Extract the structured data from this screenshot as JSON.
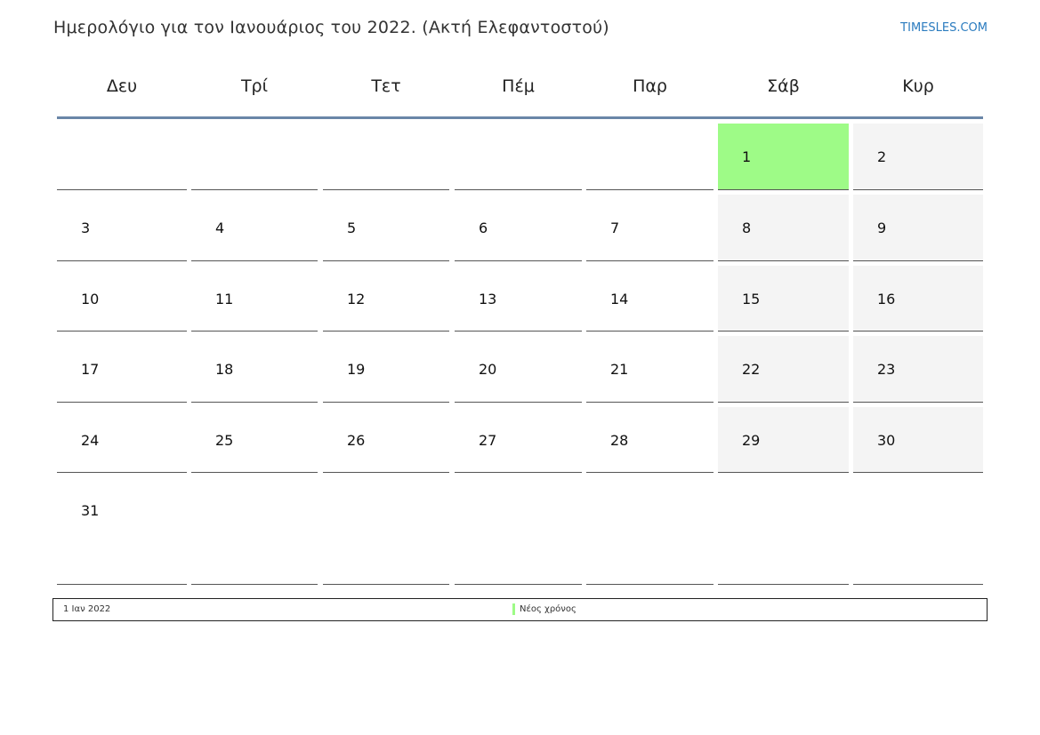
{
  "header": {
    "title": "Ημερολόγιο για τον Ιανουάριος του 2022. (Ακτή Ελεφαντοστού)",
    "brand": "TIMESLES.COM"
  },
  "weekdays": [
    "Δευ",
    "Τρί",
    "Τετ",
    "Πέμ",
    "Παρ",
    "Σάβ",
    "Κυρ"
  ],
  "weeks": [
    [
      "",
      "",
      "",
      "",
      "",
      "1",
      "2"
    ],
    [
      "3",
      "4",
      "5",
      "6",
      "7",
      "8",
      "9"
    ],
    [
      "10",
      "11",
      "12",
      "13",
      "14",
      "15",
      "16"
    ],
    [
      "17",
      "18",
      "19",
      "20",
      "21",
      "22",
      "23"
    ],
    [
      "24",
      "25",
      "26",
      "27",
      "28",
      "29",
      "30"
    ],
    [
      "31",
      "",
      "",
      "",
      "",
      "",
      ""
    ]
  ],
  "holiday_day": "1",
  "legend": {
    "date": "1 Ιαν 2022",
    "name": "Νέος χρόνος",
    "color": "#9efb87"
  },
  "colors": {
    "weekend_bg": "#f4f4f4",
    "holiday_bg": "#9efb87",
    "header_line": "#6a86a8",
    "brand": "#2a7bbf"
  }
}
